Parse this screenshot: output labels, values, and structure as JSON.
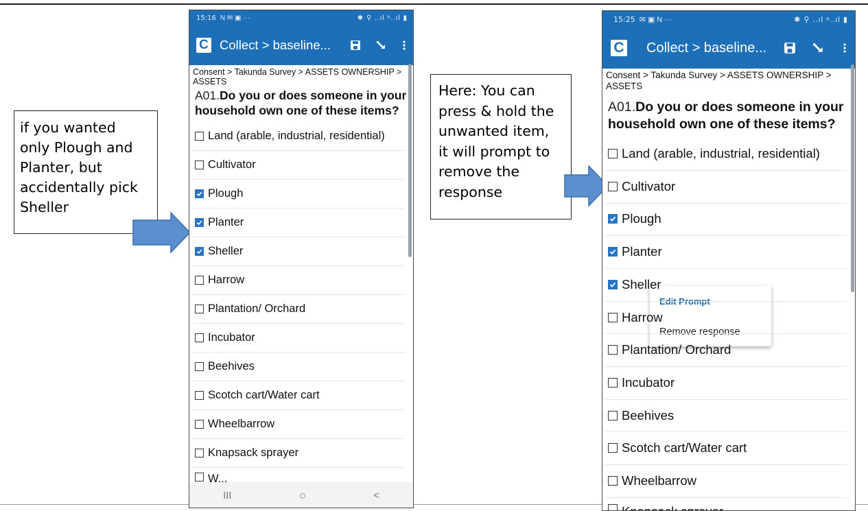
{
  "left_callout": {
    "lines": [
      "if you wanted",
      "only Plough and",
      "Planter, but",
      "accidentally pick",
      "Sheller"
    ]
  },
  "right_callout": {
    "lines": [
      "Here: You can",
      "press & hold the",
      "unwanted item,",
      "it will prompt to",
      "remove the",
      "response"
    ]
  },
  "phone_left": {
    "status": {
      "time": "15:16",
      "left_icons": "N ✉ ▣ ···",
      "right_icons": "✱ ⚲ ..ıl ᵒ..ıl ▮"
    },
    "app_title": "Collect > baseline...",
    "breadcrumb": "Consent > Takunda Survey > ASSETS OWNERSHIP > ASSETS",
    "question_code": "A01.",
    "question_text": "Do you or does someone in your household own one of these items?",
    "options": [
      {
        "label": "Land (arable, industrial, residential)",
        "checked": false
      },
      {
        "label": "Cultivator",
        "checked": false
      },
      {
        "label": "Plough",
        "checked": true
      },
      {
        "label": "Planter",
        "checked": true
      },
      {
        "label": "Sheller",
        "checked": true
      },
      {
        "label": "Harrow",
        "checked": false
      },
      {
        "label": "Plantation/ Orchard",
        "checked": false
      },
      {
        "label": "Incubator",
        "checked": false
      },
      {
        "label": "Beehives",
        "checked": false
      },
      {
        "label": "Scotch cart/Water cart",
        "checked": false
      },
      {
        "label": "Wheelbarrow",
        "checked": false
      },
      {
        "label": "Knapsack sprayer",
        "checked": false
      },
      {
        "label": "W...",
        "checked": false
      }
    ],
    "nav": {
      "recents": "III",
      "home": "○",
      "back": "<"
    }
  },
  "phone_right": {
    "status": {
      "time": "15:25",
      "left_icons": "✉ ▣ N ···",
      "right_icons": "✱ ⚲ ..ıl ᵒ..ıl ▮"
    },
    "app_title": "Collect > baseline...",
    "breadcrumb": "Consent > Takunda Survey > ASSETS OWNERSHIP > ASSETS",
    "question_code": "A01.",
    "question_text": "Do you or does someone in your household own one of these items?",
    "options": [
      {
        "label": "Land (arable, industrial, residential)",
        "checked": false
      },
      {
        "label": "Cultivator",
        "checked": false
      },
      {
        "label": "Plough",
        "checked": true
      },
      {
        "label": "Planter",
        "checked": true
      },
      {
        "label": "Sheller",
        "checked": true
      },
      {
        "label": "Harrow",
        "checked": false
      },
      {
        "label": "Plantation/ Orchard",
        "checked": false
      },
      {
        "label": "Incubator",
        "checked": false
      },
      {
        "label": "Beehives",
        "checked": false
      },
      {
        "label": "Scotch cart/Water cart",
        "checked": false
      },
      {
        "label": "Wheelbarrow",
        "checked": false
      },
      {
        "label": "Knapsack sprayer",
        "checked": false
      }
    ],
    "context_menu": {
      "edit_prompt": "Edit Prompt",
      "remove_response": "Remove response"
    }
  },
  "colors": {
    "appbar": "#1d6fb8",
    "checkbox_checked": "#2b73c5",
    "arrow": "#5b8fd0",
    "menu_accent": "#1565a8"
  }
}
